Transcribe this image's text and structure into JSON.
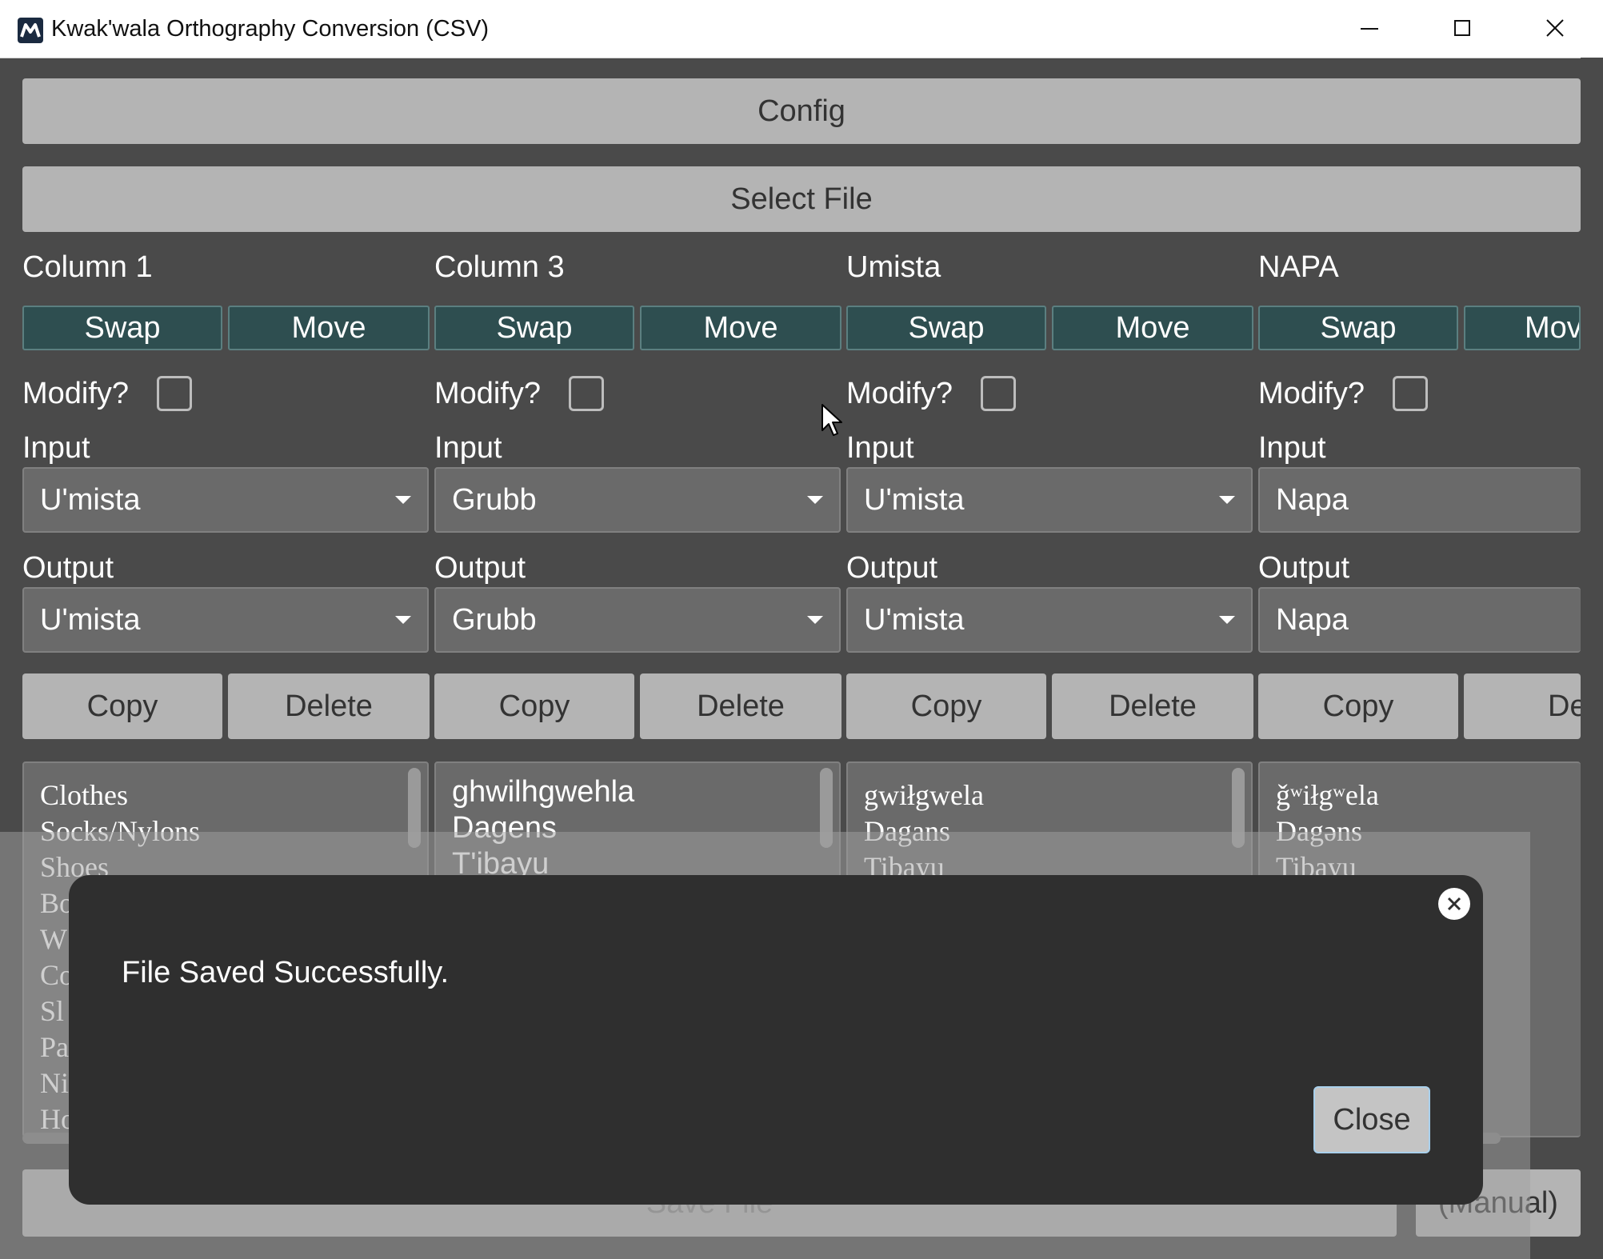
{
  "window": {
    "title": "Kwak'wala Orthography Conversion (CSV)"
  },
  "toolbar": {
    "config_label": "Config",
    "select_file_label": "Select File"
  },
  "labels": {
    "swap": "Swap",
    "move": "Move",
    "modify": "Modify?",
    "input": "Input",
    "output": "Output",
    "copy": "Copy",
    "delete": "Delete"
  },
  "columns": [
    {
      "header": "Column 1",
      "input": "U'mista",
      "output": "U'mista",
      "lines": [
        "Clothes",
        "Socks/Nylons",
        "Shoes",
        "Bo",
        "W",
        "Co",
        "Sl",
        "Pa",
        "Ni",
        "Ho"
      ]
    },
    {
      "header": "Column 3",
      "input": "Grubb",
      "output": "Grubb",
      "lines": [
        "ghwilhgwehla",
        "Dagens",
        "T'ibayu"
      ]
    },
    {
      "header": "Umista",
      "input": "U'mista",
      "output": "U'mista",
      "lines": [
        "gwiłgwela",
        "Dagans",
        "Tibayu"
      ]
    },
    {
      "header": "NAPA",
      "input": "Napa",
      "output": "Napa",
      "lines": [
        "ǧʷiłgʷela",
        "Dagəns",
        "Tibayu"
      ]
    }
  ],
  "partial_labels": {
    "move": "Mov",
    "delete": "Dele"
  },
  "bottom": {
    "save_label": "Save File",
    "manual_label": "(Manual)"
  },
  "modal": {
    "message": "File Saved Successfully.",
    "close_label": "Close"
  }
}
